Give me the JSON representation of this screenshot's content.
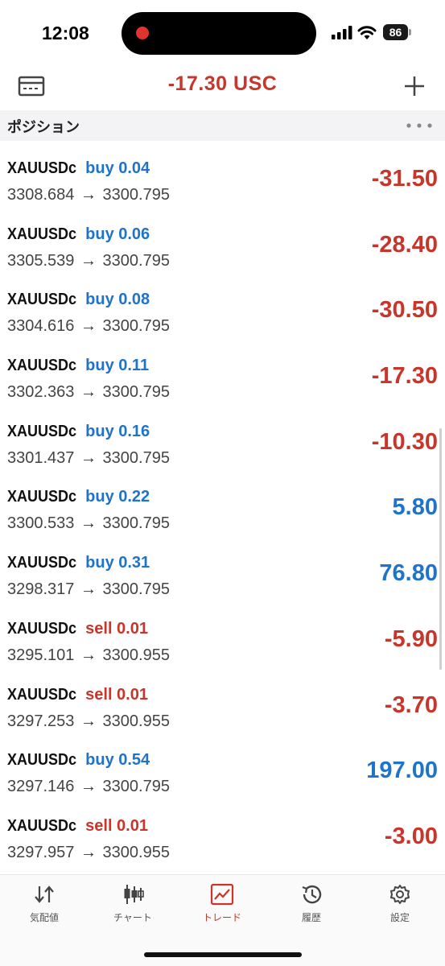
{
  "status": {
    "time": "12:08",
    "battery": "86"
  },
  "header": {
    "balance": "-17.30 USC"
  },
  "section": {
    "title": "ポジション"
  },
  "positions": [
    {
      "symbol": "XAUUSDc",
      "side": "buy",
      "lot": "buy 0.04",
      "open": "3308.684",
      "arrow": "→",
      "current": "3300.795",
      "pnl": "-31.50"
    },
    {
      "symbol": "XAUUSDc",
      "side": "buy",
      "lot": "buy 0.06",
      "open": "3305.539",
      "arrow": "→",
      "current": "3300.795",
      "pnl": "-28.40"
    },
    {
      "symbol": "XAUUSDc",
      "side": "buy",
      "lot": "buy 0.08",
      "open": "3304.616",
      "arrow": "→",
      "current": "3300.795",
      "pnl": "-30.50"
    },
    {
      "symbol": "XAUUSDc",
      "side": "buy",
      "lot": "buy 0.11",
      "open": "3302.363",
      "arrow": "→",
      "current": "3300.795",
      "pnl": "-17.30"
    },
    {
      "symbol": "XAUUSDc",
      "side": "buy",
      "lot": "buy 0.16",
      "open": "3301.437",
      "arrow": "→",
      "current": "3300.795",
      "pnl": "-10.30"
    },
    {
      "symbol": "XAUUSDc",
      "side": "buy",
      "lot": "buy 0.22",
      "open": "3300.533",
      "arrow": "→",
      "current": "3300.795",
      "pnl": "5.80"
    },
    {
      "symbol": "XAUUSDc",
      "side": "buy",
      "lot": "buy 0.31",
      "open": "3298.317",
      "arrow": "→",
      "current": "3300.795",
      "pnl": "76.80"
    },
    {
      "symbol": "XAUUSDc",
      "side": "sell",
      "lot": "sell 0.01",
      "open": "3295.101",
      "arrow": "→",
      "current": "3300.955",
      "pnl": "-5.90"
    },
    {
      "symbol": "XAUUSDc",
      "side": "sell",
      "lot": "sell 0.01",
      "open": "3297.253",
      "arrow": "→",
      "current": "3300.955",
      "pnl": "-3.70"
    },
    {
      "symbol": "XAUUSDc",
      "side": "buy",
      "lot": "buy 0.54",
      "open": "3297.146",
      "arrow": "→",
      "current": "3300.795",
      "pnl": "197.00"
    },
    {
      "symbol": "XAUUSDc",
      "side": "sell",
      "lot": "sell 0.01",
      "open": "3297.957",
      "arrow": "→",
      "current": "3300.955",
      "pnl": "-3.00"
    }
  ],
  "tabs": [
    {
      "id": "quotes",
      "label": "気配値",
      "icon": "quotes-arrows-icon"
    },
    {
      "id": "chart",
      "label": "チャート",
      "icon": "candlestick-icon"
    },
    {
      "id": "trade",
      "label": "トレード",
      "icon": "trade-chart-icon",
      "active": true
    },
    {
      "id": "history",
      "label": "履歴",
      "icon": "history-clock-icon"
    },
    {
      "id": "settings",
      "label": "設定",
      "icon": "gear-icon"
    }
  ],
  "colors": {
    "negative": "#c8352a",
    "positive": "#1f73c9",
    "active_tab": "#c8352a"
  }
}
